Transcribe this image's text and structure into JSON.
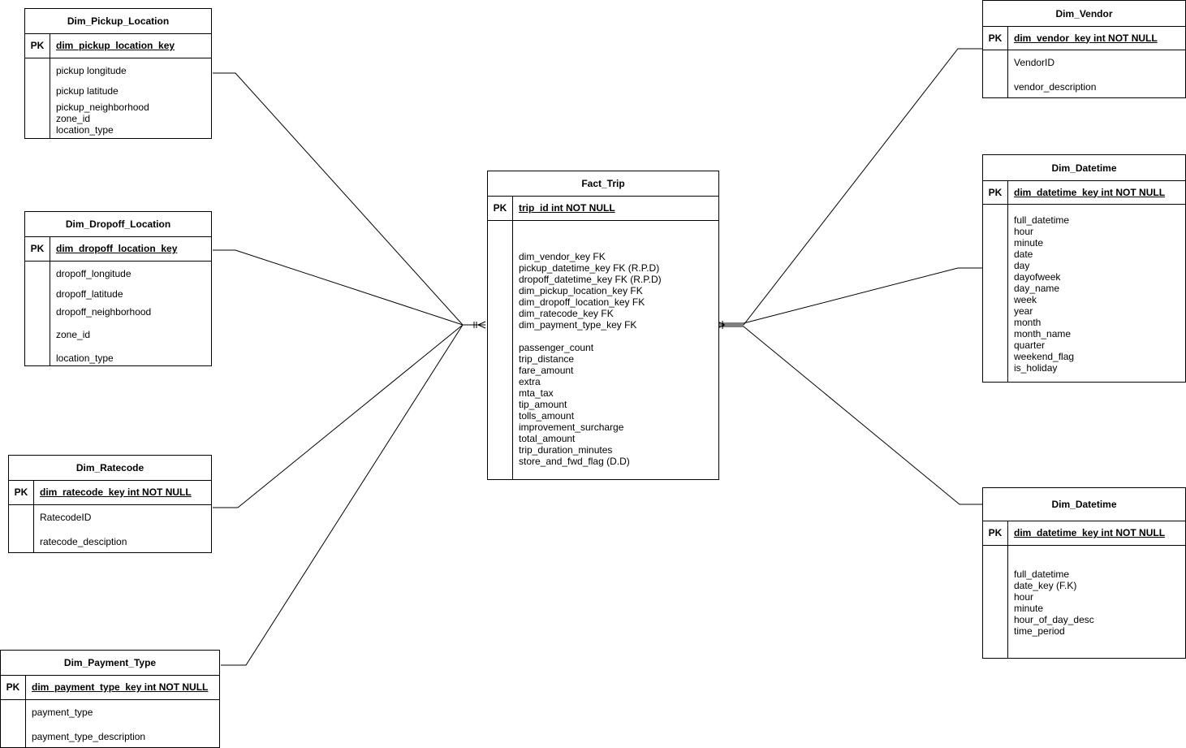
{
  "entities": {
    "pickup": {
      "title": "Dim_Pickup_Location",
      "pk_label": "PK",
      "pk_name": "dim_pickup_location_key",
      "fields": [
        "pickup longitude",
        "pickup latitude",
        "pickup_neighborhood",
        "zone_id",
        "location_type"
      ]
    },
    "dropoff": {
      "title": "Dim_Dropoff_Location",
      "pk_label": "PK",
      "pk_name": "dim_dropoff_location_key",
      "fields": [
        "dropoff_longitude",
        "dropoff_latitude",
        "dropoff_neighborhood",
        "zone_id",
        "location_type"
      ]
    },
    "ratecode": {
      "title": "Dim_Ratecode",
      "pk_label": "PK",
      "pk_name": "dim_ratecode_key int NOT NULL",
      "fields": [
        "RatecodeID",
        "ratecode_desciption"
      ]
    },
    "payment": {
      "title": "Dim_Payment_Type",
      "pk_label": "PK",
      "pk_name": "dim_payment_type_key int NOT NULL",
      "fields": [
        "payment_type",
        "payment_type_description"
      ]
    },
    "fact": {
      "title": "Fact_Trip",
      "pk_label": "PK",
      "pk_name": "trip_id int NOT NULL",
      "fields": [
        "dim_vendor_key FK",
        "pickup_datetime_key FK (R.P.D)",
        "dropoff_datetime_key FK (R.P.D)",
        "dim_pickup_location_key FK",
        "dim_dropoff_location_key FK",
        "dim_ratecode_key FK",
        "dim_payment_type_key FK",
        "passenger_count",
        "trip_distance",
        "fare_amount",
        "extra",
        "mta_tax",
        "tip_amount",
        "tolls_amount",
        "improvement_surcharge",
        "total_amount",
        "trip_duration_minutes",
        "store_and_fwd_flag (D.D)"
      ]
    },
    "vendor": {
      "title": "Dim_Vendor",
      "pk_label": "PK",
      "pk_name": "dim_vendor_key int NOT NULL",
      "fields": [
        "VendorID",
        "vendor_description"
      ]
    },
    "datetime1": {
      "title": "Dim_Datetime",
      "pk_label": "PK",
      "pk_name": "dim_datetime_key int NOT NULL",
      "fields": [
        "full_datetime",
        "hour",
        "minute",
        "date",
        "day",
        "dayofweek",
        "day_name",
        "week",
        "year",
        "month",
        "month_name",
        "quarter",
        "weekend_flag",
        "is_holiday"
      ]
    },
    "datetime2": {
      "title": "Dim_Datetime",
      "pk_label": "PK",
      "pk_name": "dim_datetime_key int NOT NULL",
      "fields": [
        "full_datetime",
        "date_key (F.K)",
        "hour",
        "minute",
        "hour_of_day_desc",
        "time_period"
      ]
    }
  }
}
